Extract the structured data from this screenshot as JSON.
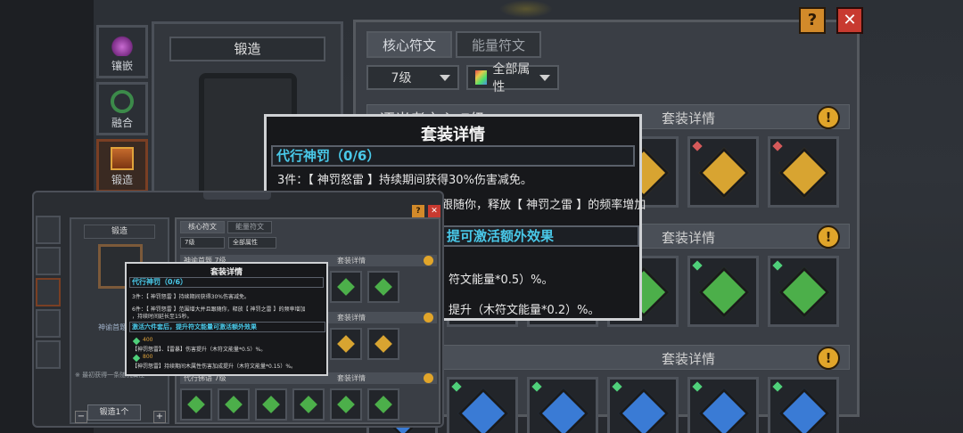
{
  "side_nav": [
    {
      "label": "镶嵌",
      "icon": "flask-icon"
    },
    {
      "label": "融合",
      "icon": "ring-icon"
    },
    {
      "label": "锻造",
      "icon": "chest-icon"
    }
  ],
  "forge": {
    "title": "锻造"
  },
  "tabs": [
    "核心符文",
    "能量符文"
  ],
  "filters": {
    "level": "7级",
    "attribute": "全部属性"
  },
  "sets": [
    {
      "name": "逐光者之心 7级",
      "detail": "套装详情"
    },
    {
      "name": "",
      "detail": "套装详情"
    },
    {
      "name": "7级",
      "detail": "套装详情"
    }
  ],
  "buttons": {
    "help": "?",
    "close": "✕",
    "info": "!"
  },
  "tooltip": {
    "title": "套装详情",
    "set_name": "代行神罚（0/6）",
    "line_3": "3件：【 神罚怒雷 】持续期间获得30%伤害减免。",
    "line_6_partial": "跟随你，释放【 神罚之雷 】的频率增加",
    "bonus_header_partial": "提可激活额外效果",
    "effect_1_partial": "符文能量*0.5）%。",
    "effect_2_partial": "提升（木符文能量*0.2）%。"
  },
  "mini": {
    "forge_title": "锻造",
    "forge_item_name": "神谕首题 7级",
    "forge_note": "※ 最初获得一条随机属性",
    "stepper_value": "1",
    "forge_button": "锻造1个",
    "tabs": [
      "核心符文",
      "能量符文"
    ],
    "filter_level": "7级",
    "filter_attr": "全部属性",
    "rows": [
      {
        "name": "神谕首题 7级",
        "detail": "套装详情"
      },
      {
        "name": "",
        "detail": "套装详情"
      },
      {
        "name": "代行佛语 7级",
        "detail": "套装详情"
      }
    ],
    "tip": {
      "title": "套装详情",
      "set_name": "代行神罚（0/6）",
      "line_3": "3件：【 神罚怒雷 】持续期间获得30%伤害减免。",
      "line_6a": "6件：【 神罚怒雷 】范围增大并且跟随你，释放【 神罚之雷 】的频率增加",
      "line_6b": "，持续时间延长至15秒。",
      "bonus_header": "激活六件套后，提升符文能量可激活额外效果",
      "val_1": "400",
      "effect_1": "【神罚怒雷】、【雷暴】伤害提升（木符文能量*0.5）%。",
      "val_2": "800",
      "effect_2": "【神罚怒雷】持续期间木属性伤害加成提升（木符文能量*0.15）%。"
    }
  },
  "colors": {
    "accent_cyan": "#49c8e8",
    "info_gold": "#e1a52a",
    "close_red": "#c83a30"
  }
}
